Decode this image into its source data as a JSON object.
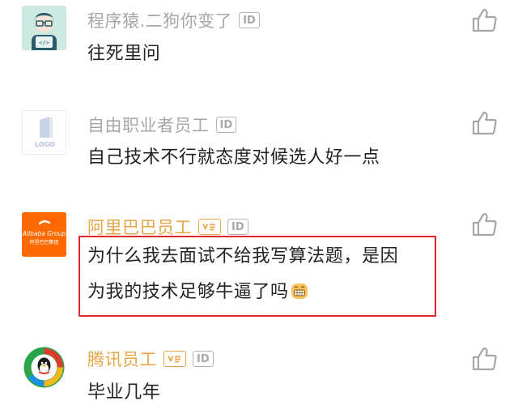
{
  "comments": [
    {
      "user": "程序猿.二狗你变了",
      "badge_id": "ID",
      "text": "往死里问",
      "avatar": "coder-avatar",
      "like_icon": "thumbs-up-icon"
    },
    {
      "user": "自由职业者员工",
      "badge_id": "ID",
      "text": "自己技术不行就态度对候选人好一点",
      "avatar": "logo-placeholder-avatar",
      "avatar_text": "LOGO",
      "like_icon": "thumbs-up-icon"
    },
    {
      "user": "阿里巴巴员工",
      "badge_id": "ID",
      "verified_icon": "verified-employee-icon",
      "text_line1": "为什么我去面试不给我写算法题，是因",
      "text_line2": "为我的技术足够牛逼了吗",
      "emoji": "grinning-emoji",
      "avatar": "alibaba-group-logo",
      "avatar_text": "Alibaba Group",
      "avatar_subtext": "阿里巴巴集团",
      "like_icon": "thumbs-up-icon",
      "highlighted": true
    },
    {
      "user": "腾讯员工",
      "badge_id": "ID",
      "verified_icon": "verified-employee-icon",
      "text": "毕业几年",
      "avatar": "tencent-qq-logo",
      "like_icon": "thumbs-up-icon"
    }
  ],
  "colors": {
    "username_gray": "#a7a7a7",
    "username_orange": "#e5a548",
    "highlight_red": "#e0262f",
    "alibaba_orange": "#ff6a00"
  }
}
